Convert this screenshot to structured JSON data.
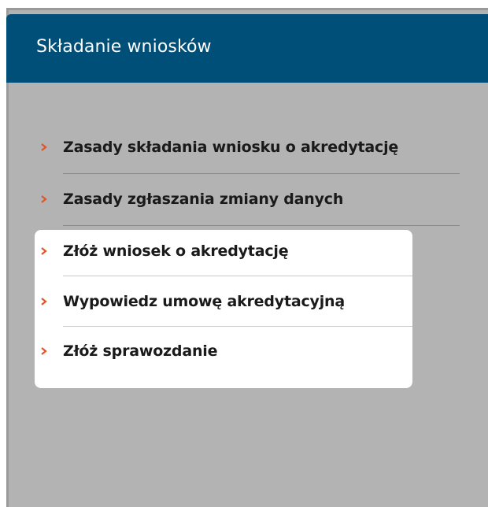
{
  "panel": {
    "title": "Składanie wniosków"
  },
  "menu": {
    "items": [
      {
        "label": "Zasady składania wniosku o akredytację",
        "icon": "chevron-right-icon"
      },
      {
        "label": "Zasady zgłaszania zmiany danych",
        "icon": "chevron-right-icon"
      },
      {
        "label": "Złóż wniosek o akredytację",
        "icon": "chevron-right-icon"
      },
      {
        "label": "Wypowiedz umowę akredytacyjną",
        "icon": "chevron-right-icon"
      },
      {
        "label": "Złóż sprawozdanie",
        "icon": "chevron-right-icon"
      }
    ]
  },
  "colors": {
    "header_background": "#004f78",
    "panel_background": "#b3b3b3",
    "chevron": "#e0562b",
    "highlight": "#ffffff"
  }
}
